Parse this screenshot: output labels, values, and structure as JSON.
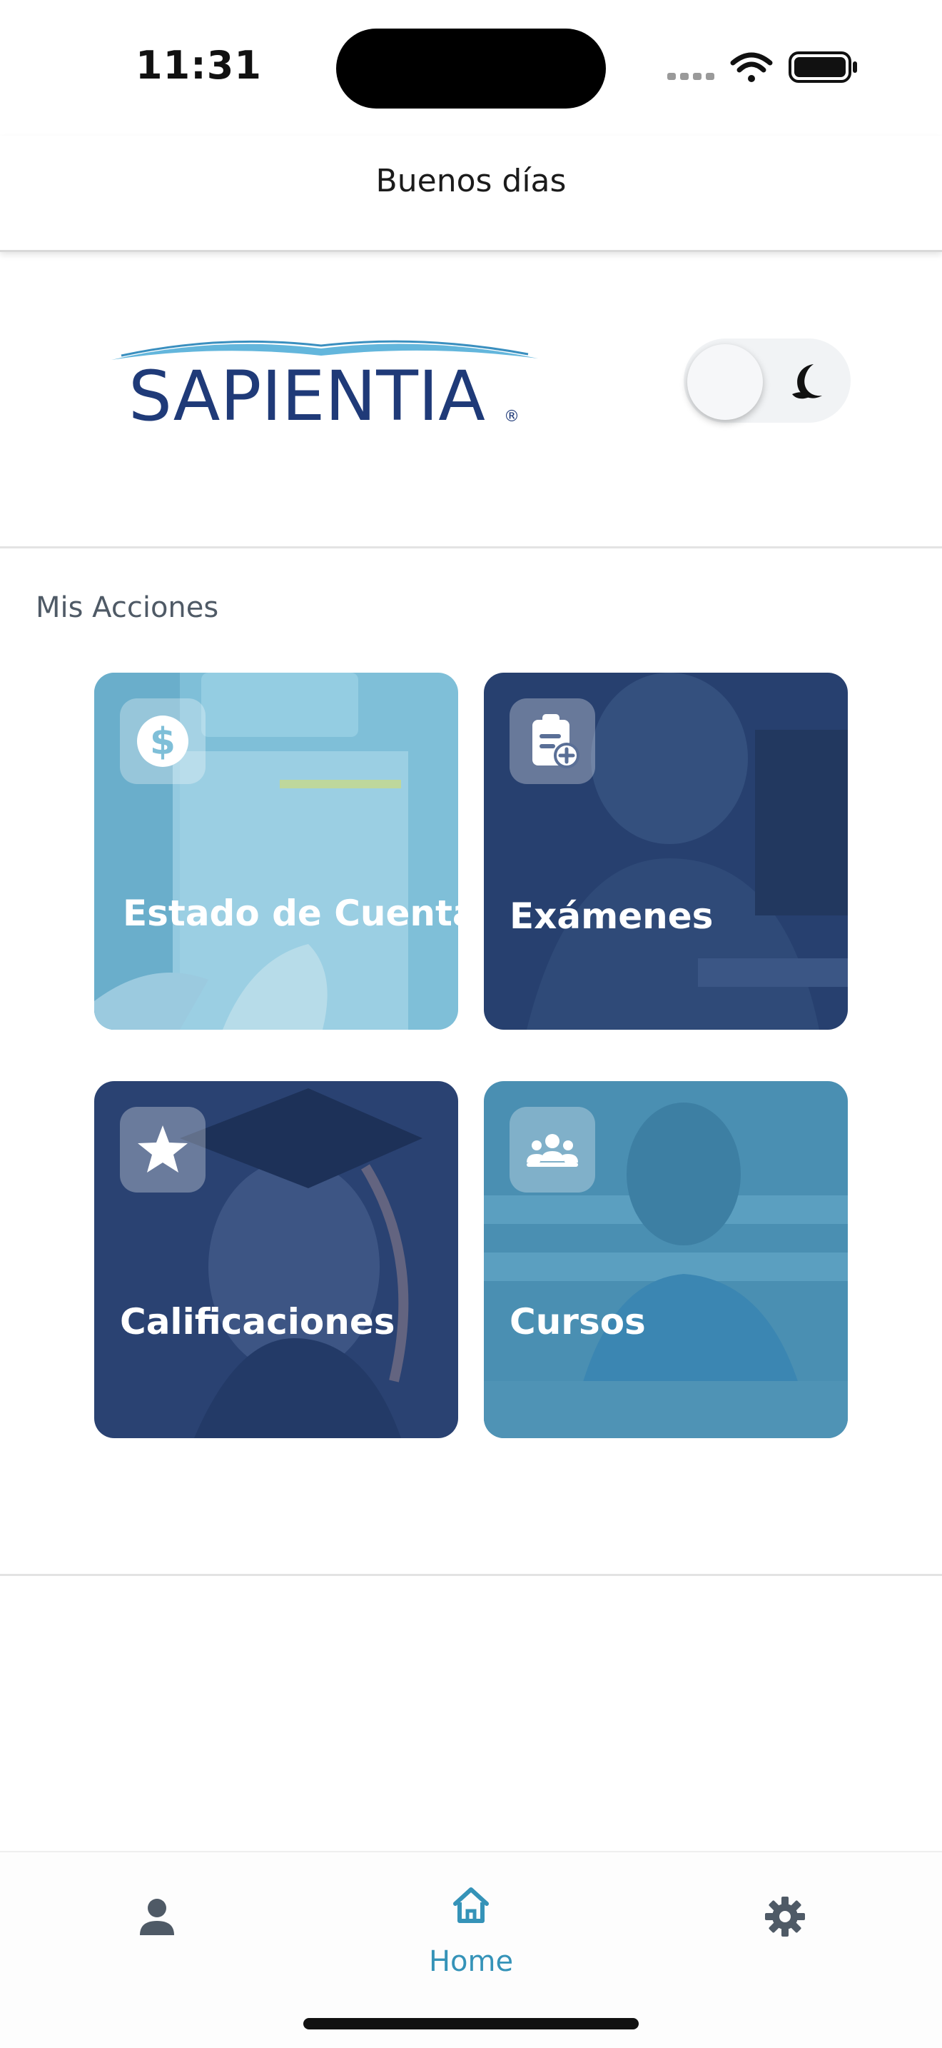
{
  "status_bar": {
    "time": "11:31"
  },
  "header": {
    "title": "Buenos días"
  },
  "logo": {
    "text": "SAPIENTIA",
    "registered_mark": "®"
  },
  "theme_toggle": {
    "state": "light",
    "icon": "moon-icon"
  },
  "section": {
    "title": "Mis Acciones"
  },
  "actions": [
    {
      "label": "Estado de Cuenta",
      "icon": "dollar-icon"
    },
    {
      "label": "Exámenes",
      "icon": "clipboard-add-icon"
    },
    {
      "label": "Calificaciones",
      "icon": "star-icon"
    },
    {
      "label": "Cursos",
      "icon": "group-icon"
    }
  ],
  "bottom_nav": {
    "items": [
      {
        "label": "",
        "icon": "person-icon",
        "active": false
      },
      {
        "label": "Home",
        "icon": "home-icon",
        "active": true
      },
      {
        "label": "",
        "icon": "gear-icon",
        "active": false
      }
    ]
  },
  "colors": {
    "accent": "#3593b8",
    "brand_navy": "#1f3a78",
    "card_light_tint": "#7fbfd8",
    "card_dark_tint": "#27406f"
  }
}
